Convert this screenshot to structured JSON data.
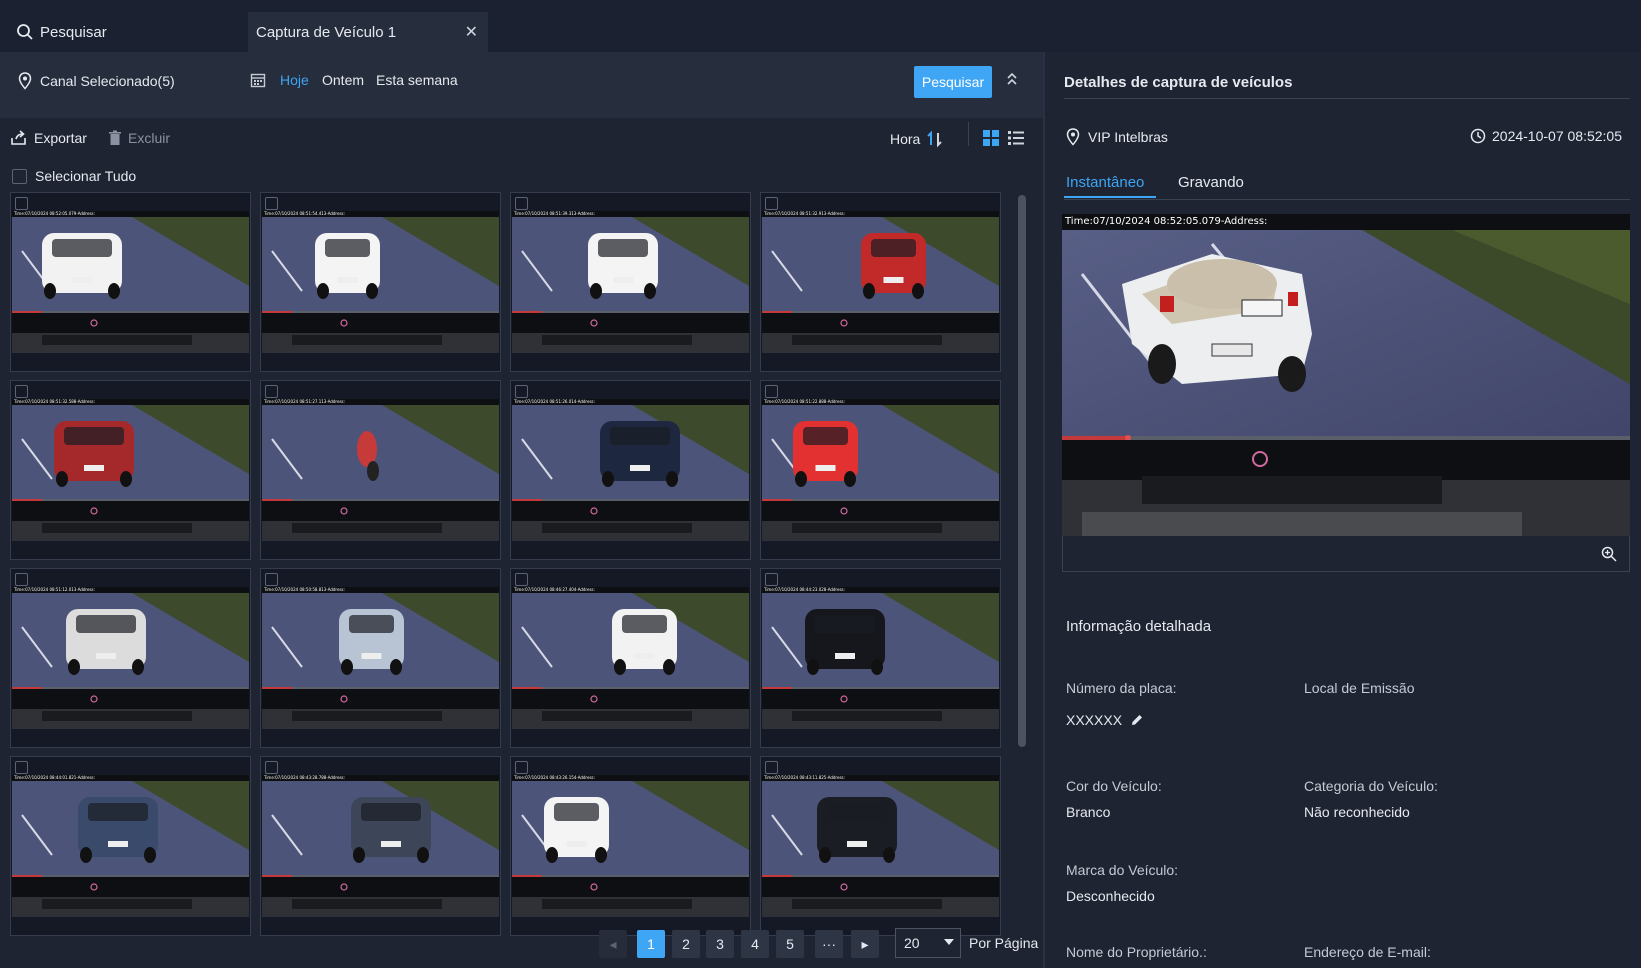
{
  "tabs": {
    "search_label": "Pesquisar",
    "capture_label": "Captura de Veículo 1"
  },
  "filter": {
    "channel_label": "Canal Selecionado(5)",
    "today": "Hoje",
    "yesterday": "Ontem",
    "this_week": "Esta semana",
    "search_button": "Pesquisar"
  },
  "toolbar": {
    "export": "Exportar",
    "delete": "Excluir",
    "sort_label": "Hora",
    "select_all": "Selecionar Tudo"
  },
  "grid": {
    "tiles": [
      {
        "stamp": "Time:07/10/2024 08:52:05.079-Address:",
        "vehicle": "pickup",
        "color": "#f2f2f2"
      },
      {
        "stamp": "Time:07/10/2024 08:51:54.413-Address:",
        "vehicle": "hatch",
        "color": "#f4f4f4"
      },
      {
        "stamp": "Time:07/10/2024 08:51:39.313-Address:",
        "vehicle": "van",
        "color": "#f4f4f4"
      },
      {
        "stamp": "Time:07/10/2024 08:51:32.913-Address:",
        "vehicle": "hatch",
        "color": "#c22a2a"
      },
      {
        "stamp": "Time:07/10/2024 08:51:32.588-Address:",
        "vehicle": "suv",
        "color": "#a5282a"
      },
      {
        "stamp": "Time:07/10/2024 08:51:27.113-Address:",
        "vehicle": "moto",
        "color": "#c73a3a"
      },
      {
        "stamp": "Time:07/10/2024 08:51:26.014-Address:",
        "vehicle": "suv",
        "color": "#1d2740"
      },
      {
        "stamp": "Time:07/10/2024 08:51:22.888-Address:",
        "vehicle": "hatch",
        "color": "#e33030"
      },
      {
        "stamp": "Time:07/10/2024 08:51:12.013-Address:",
        "vehicle": "suv",
        "color": "#dcdcdc"
      },
      {
        "stamp": "Time:07/10/2024 08:50:58.813-Address:",
        "vehicle": "sedan",
        "color": "#b8c4d4"
      },
      {
        "stamp": "Time:07/10/2024 08:46:27.404-Address:",
        "vehicle": "sedan",
        "color": "#f2f2f2"
      },
      {
        "stamp": "Time:07/10/2024 08:44:23.028-Address:",
        "vehicle": "suv",
        "color": "#15171d"
      },
      {
        "stamp": "Time:07/10/2024 08:44:01.821-Address:",
        "vehicle": "suv",
        "color": "#3a4a6a"
      },
      {
        "stamp": "Time:07/10/2024 08:43:28.788-Address:",
        "vehicle": "suv",
        "color": "#3d4658"
      },
      {
        "stamp": "Time:07/10/2024 08:43:26.154-Address:",
        "vehicle": "hatch",
        "color": "#f4f4f4"
      },
      {
        "stamp": "Time:07/10/2024 08:43:11.825-Address:",
        "vehicle": "suv",
        "color": "#1b1d24"
      }
    ]
  },
  "pagination": {
    "pages": [
      "1",
      "2",
      "3",
      "4",
      "5"
    ],
    "ellipsis": "···",
    "per_page_value": "20",
    "per_page_label": "Por Página",
    "current_page": 1
  },
  "details": {
    "title": "Detalhes de captura de veículos",
    "location": "VIP Intelbras",
    "datetime": "2024-10-07 08:52:05",
    "tab_snapshot": "Instantâneo",
    "tab_recording": "Gravando",
    "snapshot_stamp": "Time:07/10/2024 08:52:05.079-Address:",
    "section_title": "Informação detalhada",
    "plate_label": "Número da placa:",
    "plate_value": "XXXXXX",
    "emission_label": "Local de Emissão",
    "color_label": "Cor do Veículo:",
    "color_value": "Branco",
    "category_label": "Categoria do Veículo:",
    "category_value": "Não reconhecido",
    "brand_label": "Marca do Veículo:",
    "brand_value": "Desconhecido",
    "owner_label": "Nome do Proprietário.:",
    "email_label": "Endereço de E-mail:"
  },
  "colors": {
    "accent": "#3ea6f5",
    "background": "#1e2432",
    "panel": "#262d3c"
  }
}
